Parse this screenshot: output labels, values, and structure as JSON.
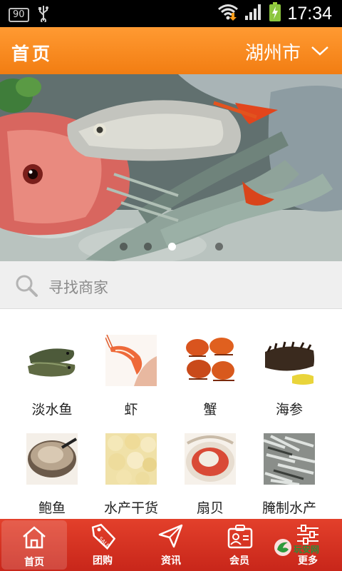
{
  "status_bar": {
    "badge": "90",
    "time": "17:34"
  },
  "header": {
    "title": "首页",
    "city": "湖州市"
  },
  "banner": {
    "slide_count": 4,
    "active_slide": 3
  },
  "search": {
    "placeholder": "寻找商家"
  },
  "categories": [
    {
      "label": "淡水鱼"
    },
    {
      "label": "虾"
    },
    {
      "label": "蟹"
    },
    {
      "label": "海参"
    },
    {
      "label": "鲍鱼"
    },
    {
      "label": "水产干货"
    },
    {
      "label": "扇贝"
    },
    {
      "label": "腌制水产"
    }
  ],
  "bottom_nav": [
    {
      "label": "首页",
      "icon": "home-icon",
      "active": true
    },
    {
      "label": "团购",
      "icon": "sale-tag-icon",
      "active": false
    },
    {
      "label": "资讯",
      "icon": "paper-plane-icon",
      "active": false
    },
    {
      "label": "会员",
      "icon": "member-card-icon",
      "active": false
    },
    {
      "label": "更多",
      "icon": "sliders-icon",
      "active": false
    }
  ],
  "watermark": {
    "text": "玩安网"
  },
  "colors": {
    "header": "#f58a1f",
    "bottom_nav": "#d9311f",
    "search_bg": "#efefef"
  }
}
